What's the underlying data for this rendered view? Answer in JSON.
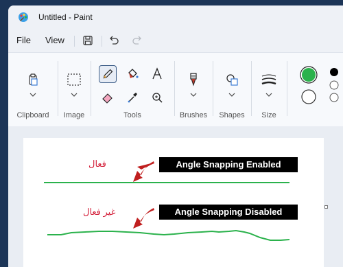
{
  "window": {
    "title": "Untitled - Paint"
  },
  "menu": {
    "file": "File",
    "view": "View"
  },
  "ribbon": {
    "clipboard": "Clipboard",
    "image": "Image",
    "tools": "Tools",
    "brushes": "Brushes",
    "shapes": "Shapes",
    "size": "Size"
  },
  "colors": {
    "primary": "#2bb24c",
    "secondary": "#ffffff",
    "palette_first": "#000000"
  },
  "canvas": {
    "label_enabled": "Angle Snapping Enabled",
    "label_disabled": "Angle Snapping Disabled",
    "arabic_active": "فعال",
    "arabic_inactive": "غير فعال",
    "line_color": "#2bb24c",
    "text_color": "#d4213b"
  },
  "icons": [
    "paint-app-icon",
    "save-icon",
    "undo-icon",
    "redo-icon",
    "clipboard-icon",
    "select-icon",
    "pencil-icon",
    "fill-icon",
    "text-icon",
    "eraser-icon",
    "color-picker-icon",
    "magnifier-icon",
    "brush-icon",
    "shapes-icon",
    "size-icon",
    "chevron-down-icon"
  ]
}
